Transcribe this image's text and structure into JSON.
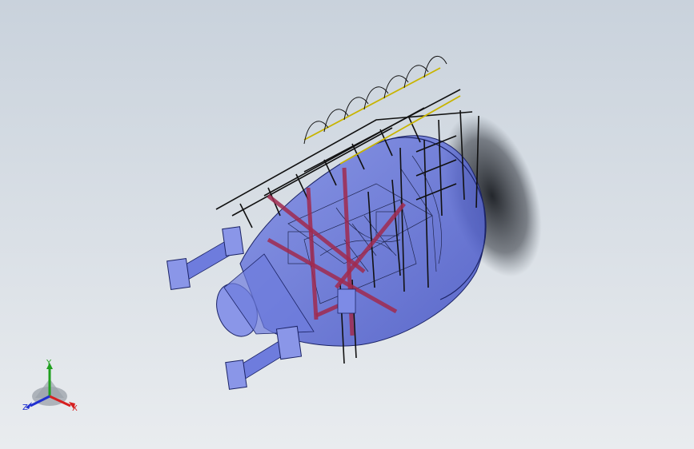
{
  "viewport": {
    "background_top": "#c9d2dc",
    "background_bottom": "#e9ecef"
  },
  "model": {
    "body_color": "#5b6cd8",
    "body_edge_color": "#1b2366",
    "frame_color": "#111111",
    "beam_color": "#a02a4f",
    "rail_color": "#c8b400"
  },
  "triad": {
    "x_label": "X",
    "y_label": "Y",
    "z_label": "Z",
    "x_color": "#d62020",
    "y_color": "#20a020",
    "z_color": "#2030d0"
  }
}
